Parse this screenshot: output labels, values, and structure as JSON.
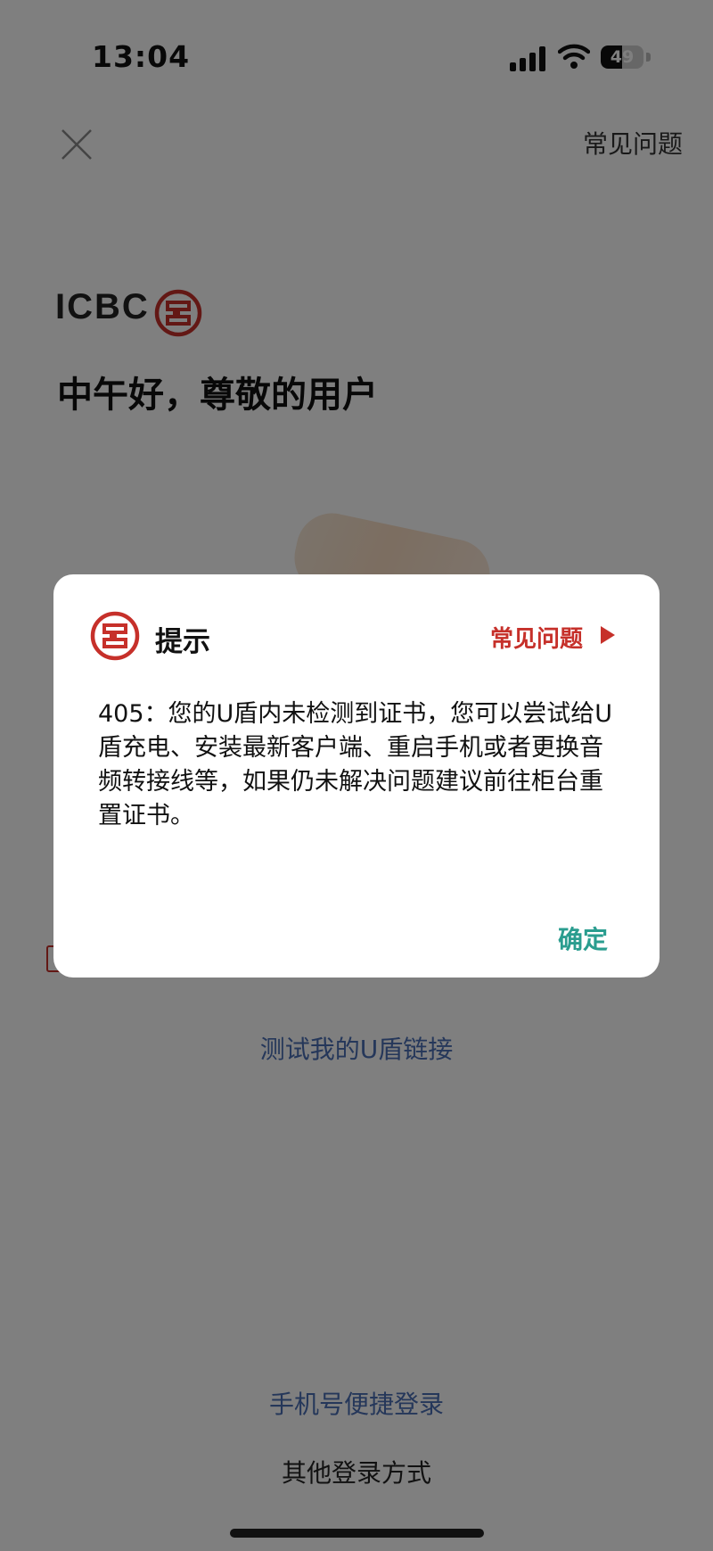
{
  "status_bar": {
    "time": "13:04",
    "battery": "49",
    "battery_level": 0.49
  },
  "nav": {
    "faq_label": "常见问题"
  },
  "brand": {
    "logo_text": "ICBC"
  },
  "greeting": "中午好，尊敬的用户",
  "links": {
    "test_usb_key": "测试我的U盾链接",
    "phone_login": "手机号便捷登录",
    "other_login": "其他登录方式"
  },
  "dialog": {
    "title": "提示",
    "faq_label": "常见问题",
    "message": "405：您的U盾内未检测到证书，您可以尝试给U盾充电、安装最新客户端、重启手机或者更换音频转接线等，如果仍未解决问题建议前往柜台重置证书。",
    "confirm_label": "确定"
  },
  "colors": {
    "brand_red": "#c6302a",
    "link_blue": "#4a6fb5",
    "confirm_teal": "#2a9d8f"
  }
}
